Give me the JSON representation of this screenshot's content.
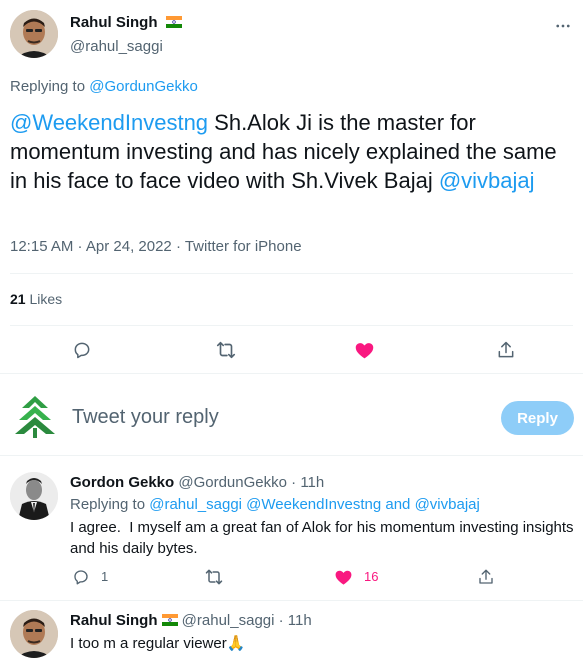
{
  "main_tweet": {
    "author_name": "Rahul Singh",
    "author_handle": "@rahul_saggi",
    "replying_prefix": "Replying to",
    "replying_to": "@GordunGekko",
    "mention1": "@WeekendInvestng",
    "text_body": " Sh.Alok Ji is the master for momentum investing and has nicely explained the same in his face to face video with Sh.Vivek Bajaj ",
    "mention2": "@vivbajaj",
    "meta": "12:15 AM · Apr 24, 2022 · Twitter for iPhone",
    "likes_count": "21",
    "likes_label": "Likes"
  },
  "composer": {
    "placeholder": "Tweet your reply",
    "reply_button": "Reply"
  },
  "reply1": {
    "author_name": "Gordon Gekko",
    "author_handle": "@GordunGekko",
    "time": "· 11h",
    "replying_prefix": "Replying to",
    "mentions_a": "@rahul_saggi @WeekendInvestng",
    "and_text": "and",
    "mentions_b": "@vivbajaj",
    "text": "I agree.  I myself am a great fan of Alok for his momentum investing insights and his daily bytes.",
    "reply_count": "1",
    "like_count": "16"
  },
  "reply2": {
    "author_name": "Rahul Singh",
    "author_handle": "@rahul_saggi",
    "time": "· 11h",
    "text": "I too m a regular viewer",
    "emoji": "🙏"
  },
  "colors": {
    "accent": "#1d9bf0",
    "like": "#f91880",
    "muted": "#536471",
    "reply_button_bg": "#8ecdf8"
  },
  "icons": [
    "more-icon",
    "reply-icon",
    "retweet-icon",
    "heart-icon",
    "share-icon",
    "india-flag-icon",
    "praying-hands-icon",
    "brand-logo-icon"
  ]
}
